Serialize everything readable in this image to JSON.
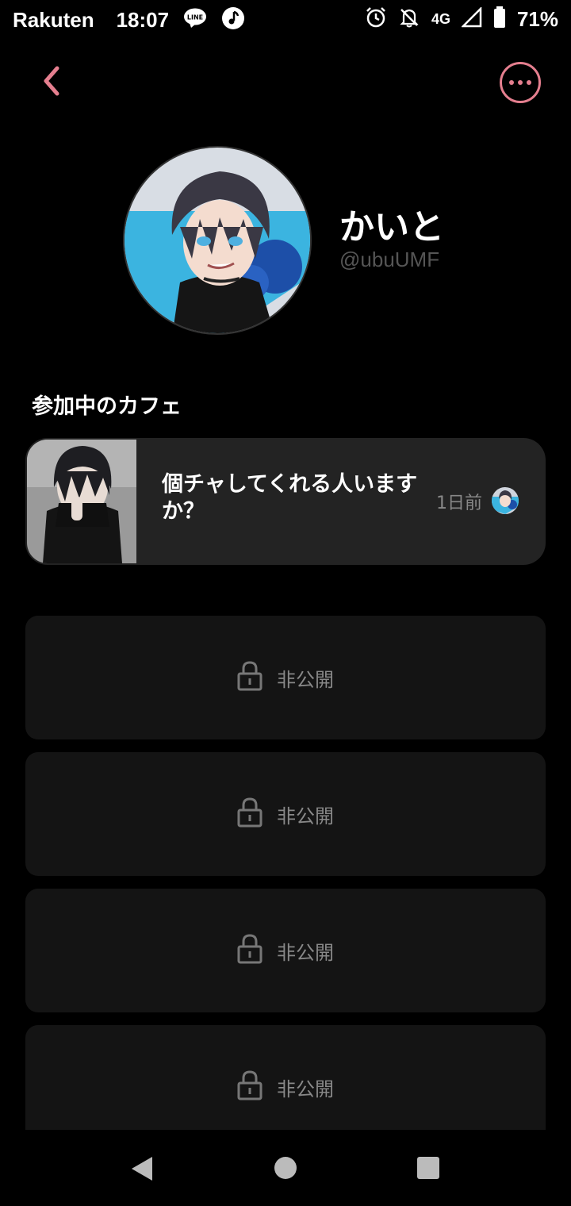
{
  "status_bar": {
    "carrier": "Rakuten",
    "time": "18:07",
    "network": "4G",
    "battery": "71%"
  },
  "profile": {
    "display_name": "かいと",
    "handle": "@ubuUMF"
  },
  "section": {
    "title": "参加中のカフェ"
  },
  "cafe": {
    "title": "個チャしてくれる人いますか？",
    "time_ago": "1日前"
  },
  "private_cards": [
    {
      "label": "非公開"
    },
    {
      "label": "非公開"
    },
    {
      "label": "非公開"
    },
    {
      "label": "非公開"
    }
  ],
  "colors": {
    "accent": "#e57f8f",
    "card_bg": "#232323",
    "private_bg": "#141414"
  },
  "icons": {
    "back": "chevron-left-icon",
    "more": "more-horizontal-icon",
    "lock": "lock-icon"
  }
}
